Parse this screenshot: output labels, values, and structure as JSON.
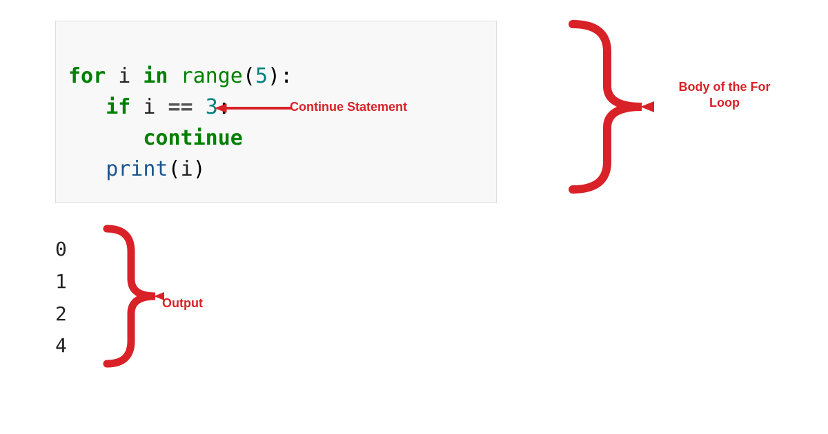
{
  "code": {
    "line1": {
      "kw_for": "for",
      "var_i": "i",
      "kw_in": "in",
      "builtin_range": "range",
      "paren_open": "(",
      "num": "5",
      "paren_close": ")",
      "colon": ":"
    },
    "line2": {
      "indent": "   ",
      "kw_if": "if",
      "var_i": "i",
      "op_eq": "==",
      "num": "3",
      "colon": ":"
    },
    "line3": {
      "indent": "      ",
      "kw_continue": "continue"
    },
    "line4": {
      "indent": "   ",
      "func_print": "print",
      "paren_open": "(",
      "var_i": "i",
      "paren_close": ")"
    }
  },
  "annotations": {
    "continue_stmt": "Continue Statement",
    "body_label": "Body of the For Loop",
    "output_label": "Output"
  },
  "output": [
    "0",
    "1",
    "2",
    "4"
  ],
  "colors": {
    "annotation_red": "#d92128",
    "keyword_green": "#008000",
    "code_bg": "#f8f8f8"
  }
}
